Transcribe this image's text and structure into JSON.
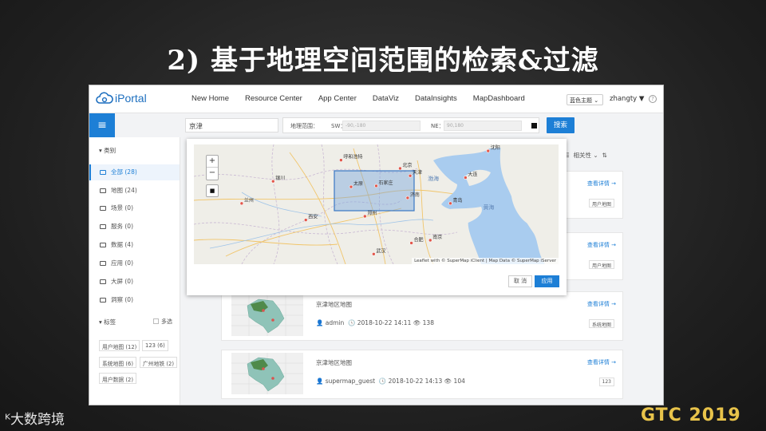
{
  "slide": {
    "title": "2) 基于地理空间范围的检索&过滤",
    "watermark_left": "大数跨境",
    "watermark_right": "GTC 2019"
  },
  "app": {
    "logo": "iPortal",
    "nav": [
      "New Home",
      "Resource Center",
      "App Center",
      "DataViz",
      "DataInsights",
      "MapDashboard"
    ],
    "theme_select": "蓝色主题",
    "user": "zhangty"
  },
  "search": {
    "query": "京津",
    "range_label": "地理范围：",
    "sw_label": "SW：",
    "sw_value": "-90,-180",
    "ne_label": "NE：",
    "ne_value": "90,180",
    "search_button": "搜索"
  },
  "sidebar": {
    "category_header": "类别",
    "items": [
      {
        "label": "全部 (28)",
        "active": true
      },
      {
        "label": "地图 (24)",
        "active": false
      },
      {
        "label": "场景 (0)",
        "active": false
      },
      {
        "label": "服务 (0)",
        "active": false
      },
      {
        "label": "数据 (4)",
        "active": false
      },
      {
        "label": "应用 (0)",
        "active": false
      },
      {
        "label": "大屏 (0)",
        "active": false
      },
      {
        "label": "洞察 (0)",
        "active": false
      }
    ],
    "tags_header": "标签",
    "multi_select": "多选",
    "tags": [
      "用户地图 (12)",
      "123 (6)",
      "系统地图 (6)",
      "广州地铁 (2)",
      "用户数据 (2)"
    ]
  },
  "list": {
    "sort_label": "相关性",
    "cards": [
      {
        "title": "",
        "meta": "",
        "link": "查看详情 →",
        "tag": "用户地图"
      },
      {
        "title": "",
        "meta": "",
        "link": "查看详情 →",
        "tag": "用户地图"
      },
      {
        "title": "京津地区地图",
        "user": "admin",
        "date": "2018-10-22 14:11",
        "views": "138",
        "link": "查看详情 →",
        "tag": "系统地图"
      },
      {
        "title": "京津地区地图",
        "user": "supermap_guest",
        "date": "2018-10-22 14:13",
        "views": "104",
        "link": "查看详情 →",
        "tag": "123"
      }
    ]
  },
  "map_popup": {
    "zoom_in": "+",
    "zoom_out": "−",
    "attribution": "Leaflet with © SuperMap iClient | Map Data © SuperMap iServer",
    "cancel": "取 消",
    "apply": "应用",
    "places": [
      {
        "name": "呼和浩特",
        "lon": 111.7,
        "lat": 40.8
      },
      {
        "name": "北京",
        "lon": 116.4,
        "lat": 39.9
      },
      {
        "name": "天津",
        "lon": 117.2,
        "lat": 39.1
      },
      {
        "name": "石家庄",
        "lon": 114.5,
        "lat": 38.0
      },
      {
        "name": "太原",
        "lon": 112.5,
        "lat": 37.9
      },
      {
        "name": "济南",
        "lon": 117.0,
        "lat": 36.7
      },
      {
        "name": "郑州",
        "lon": 113.6,
        "lat": 34.7
      },
      {
        "name": "西安",
        "lon": 108.9,
        "lat": 34.3
      },
      {
        "name": "银川",
        "lon": 106.3,
        "lat": 38.5
      },
      {
        "name": "兰州",
        "lon": 103.8,
        "lat": 36.1
      },
      {
        "name": "南京",
        "lon": 118.8,
        "lat": 32.1
      },
      {
        "name": "合肥",
        "lon": 117.3,
        "lat": 31.8
      },
      {
        "name": "武汉",
        "lon": 114.3,
        "lat": 30.6
      },
      {
        "name": "沈阳",
        "lon": 123.4,
        "lat": 41.8
      },
      {
        "name": "大连",
        "lon": 121.6,
        "lat": 38.9
      },
      {
        "name": "青岛",
        "lon": 120.4,
        "lat": 36.1
      }
    ],
    "sea_labels": [
      "渤海",
      "黄海"
    ]
  },
  "colors": {
    "primary": "#1d7fd6",
    "sea": "#a9ccef",
    "land": "#efeee8",
    "selection": "#7aa7dd"
  }
}
